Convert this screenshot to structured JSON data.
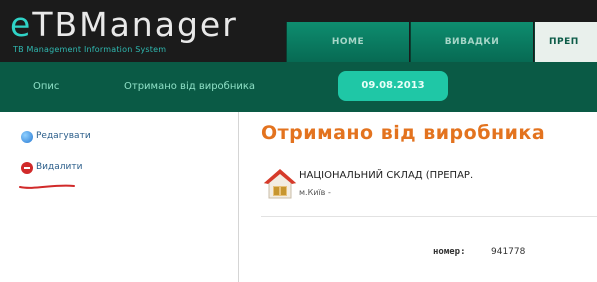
{
  "header": {
    "logo_title_e": "e",
    "logo_title_rest": "TBManager",
    "logo_subtitle": "TB Management Information System",
    "tabs": [
      {
        "label": "HOME",
        "active": false
      },
      {
        "label": "ВИВАДКИ",
        "active": false
      },
      {
        "label": "ПРЕП",
        "active": true
      }
    ]
  },
  "subbar": {
    "crumbs": [
      "Опис",
      "Отримано від виробника"
    ],
    "date": "09.08.2013"
  },
  "sidebar": {
    "items": [
      {
        "label": "Редагувати",
        "icon": "edit-globe-icon"
      },
      {
        "label": "Видалити",
        "icon": "delete-icon"
      }
    ]
  },
  "main": {
    "title": "Отримано від виробника",
    "warehouse_name": "НАЦІОНАЛЬНИЙ СКЛАД (ПРЕПАР.",
    "warehouse_city": "м.Київ -",
    "number_label": "номер:",
    "number_value": "941778"
  },
  "colors": {
    "header_bg": "#1b1b1b",
    "tab_green": "#0e8d6f",
    "subbar_bg": "#0a5a45",
    "date_pill": "#1fc7a6",
    "title_orange": "#e3731f",
    "delete_red": "#d12a2a"
  }
}
